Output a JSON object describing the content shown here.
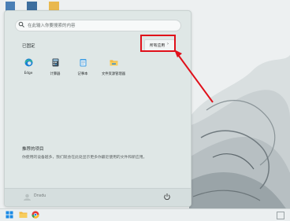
{
  "search": {
    "placeholder": "在此输入你要搜索的内容"
  },
  "pinned": {
    "title": "已固定",
    "all_apps_label": "所有应用",
    "items": [
      {
        "label": "Edge",
        "icon": "edge-icon"
      },
      {
        "label": "计算器",
        "icon": "calculator-icon"
      },
      {
        "label": "记事本",
        "icon": "notepad-icon"
      },
      {
        "label": "文件资源管理器",
        "icon": "file-explorer-icon"
      }
    ]
  },
  "recommended": {
    "title": "推荐的项目",
    "description": "你使用的设备越多，我们就会在此处显示更多你最近使用的文件和新应用。"
  },
  "footer": {
    "user_name": "Dnsdu"
  },
  "colors": {
    "highlight": "#e0101a",
    "edge": "#1a7fd6",
    "folder": "#f2b53a"
  }
}
